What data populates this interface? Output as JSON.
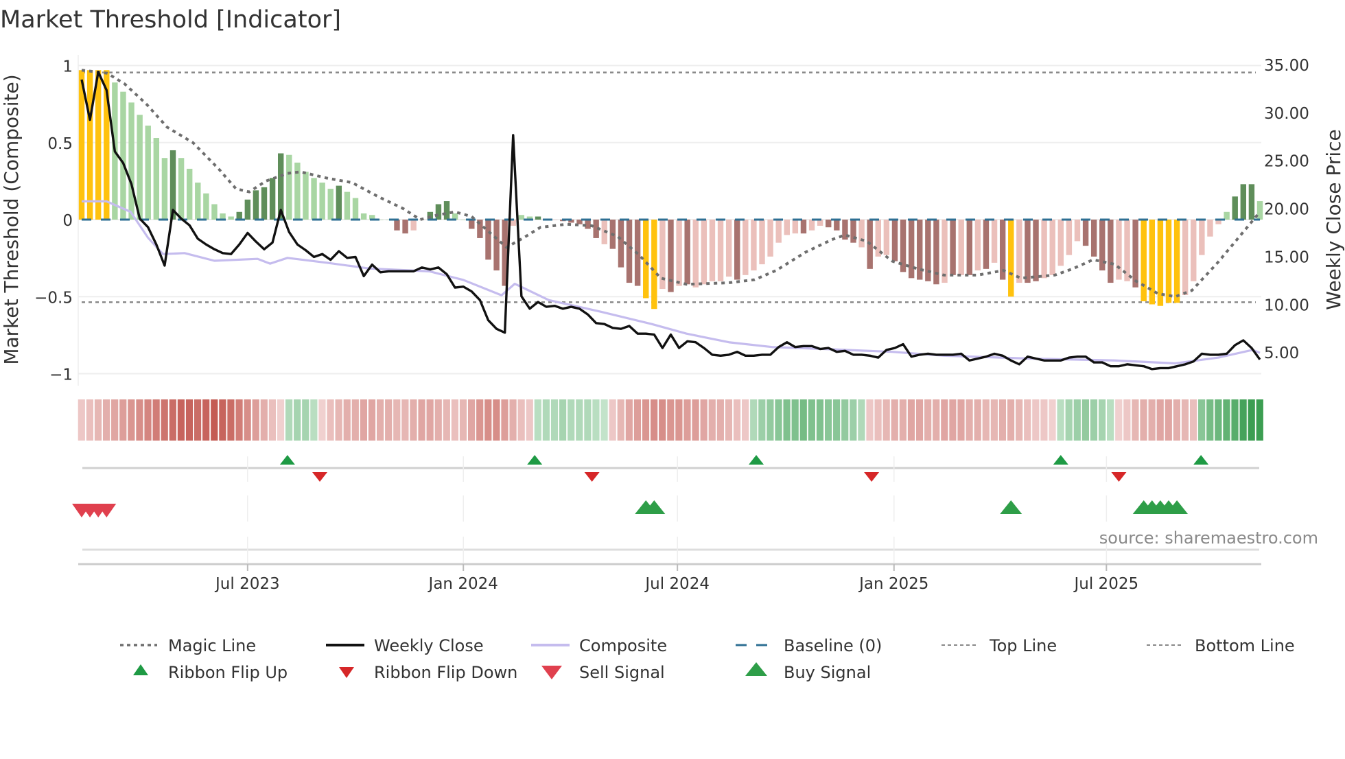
{
  "title": "Market Threshold [Indicator]",
  "source": "source: sharemaestro.com",
  "colors": {
    "Y": "#FFC20E",
    "G": "#A9D6A3",
    "D": "#5F8E5A",
    "r": "#EBC0BB",
    "R": "#A8736F",
    "close": "#111111",
    "composite": "#C5BCEE",
    "magic": "#6E6E6E",
    "baseline": "#2E6F93",
    "flip_up": "#1E9A44",
    "flip_down": "#D62728",
    "sell": "#E0404E",
    "buy": "#2E9E48"
  },
  "chart_data": {
    "type": "bar+line",
    "title": "Market Threshold [Indicator]",
    "ylabel": "Market Threshold (Composite)",
    "y2label": "Weekly Close Price",
    "ylim": [
      -1.05,
      1.05
    ],
    "y2lim": [
      2,
      36
    ],
    "yticks": [
      {
        "v": 1,
        "label": "1"
      },
      {
        "v": 0.5,
        "label": "0.5"
      },
      {
        "v": 0,
        "label": "0"
      },
      {
        "v": -0.5,
        "label": "−0.5"
      },
      {
        "v": -1,
        "label": "−1"
      }
    ],
    "y2ticks": [
      {
        "v": 35,
        "label": "35.00"
      },
      {
        "v": 30,
        "label": "30.00"
      },
      {
        "v": 25,
        "label": "25.00"
      },
      {
        "v": 20,
        "label": "20.00"
      },
      {
        "v": 15,
        "label": "15.00"
      },
      {
        "v": 10,
        "label": "10.00"
      },
      {
        "v": 5,
        "label": "5.00"
      }
    ],
    "xticks": [
      {
        "week": 20,
        "label": "Jul 2023"
      },
      {
        "week": 46,
        "label": "Jan 2024"
      },
      {
        "week": 71.8,
        "label": "Jul 2024"
      },
      {
        "week": 97.9,
        "label": "Jan 2025"
      },
      {
        "week": 123.5,
        "label": "Jul 2025"
      }
    ],
    "x_unit": "week index (weekly, ~Feb 2023 to ~Nov 2025)",
    "top_line": 0.955,
    "bottom_line": -0.536,
    "baseline": 0,
    "bars": {
      "values": [
        0.97,
        0.97,
        0.97,
        0.97,
        0.89,
        0.83,
        0.76,
        0.68,
        0.61,
        0.53,
        0.4,
        0.45,
        0.4,
        0.33,
        0.24,
        0.17,
        0.1,
        0.04,
        0.02,
        0.05,
        0.13,
        0.19,
        0.21,
        0.27,
        0.43,
        0.42,
        0.37,
        0.31,
        0.27,
        0.24,
        0.2,
        0.22,
        0.18,
        0.14,
        0.04,
        0.03,
        0,
        0,
        -0.07,
        -0.09,
        -0.07,
        0,
        0.05,
        0.1,
        0.12,
        0.04,
        0,
        -0.06,
        -0.12,
        -0.26,
        -0.33,
        -0.43,
        -0.04,
        0.03,
        0.02,
        0.02,
        0,
        0,
        -0.01,
        -0.02,
        -0.03,
        -0.06,
        -0.12,
        -0.16,
        -0.19,
        -0.31,
        -0.41,
        -0.43,
        -0.51,
        -0.58,
        -0.45,
        -0.47,
        -0.43,
        -0.42,
        -0.44,
        -0.42,
        -0.4,
        -0.4,
        -0.37,
        -0.39,
        -0.36,
        -0.33,
        -0.29,
        -0.24,
        -0.15,
        -0.1,
        -0.09,
        -0.09,
        -0.07,
        -0.04,
        -0.05,
        -0.07,
        -0.13,
        -0.15,
        -0.18,
        -0.32,
        -0.24,
        -0.23,
        -0.27,
        -0.34,
        -0.38,
        -0.39,
        -0.4,
        -0.42,
        -0.41,
        -0.36,
        -0.36,
        -0.36,
        -0.33,
        -0.32,
        -0.28,
        -0.39,
        -0.5,
        -0.41,
        -0.41,
        -0.4,
        -0.38,
        -0.36,
        -0.3,
        -0.23,
        -0.14,
        -0.17,
        -0.24,
        -0.33,
        -0.41,
        -0.39,
        -0.4,
        -0.44,
        -0.53,
        -0.55,
        -0.56,
        -0.54,
        -0.54,
        -0.49,
        -0.4,
        -0.23,
        -0.11,
        -0.03,
        0.05,
        0.15,
        0.23,
        0.23,
        0.12
      ],
      "color_codes": "YYYYGGGGGGGDGGGGGGGDDDDDDGGGGGGDGGGGGGRRrrDDDGGRRRRRrGGDDrRRRRRrRRRRYYrRrRrrrrrRrrrrrrrRrrRRRRrRrrRRRRRRrRrRrRrRYrRRrrrrrRRRRrrRYYYYYrrrrrGDDDG"
    },
    "weekly_close": [
      33.5,
      29.3,
      34.3,
      32.4,
      26,
      24.8,
      22.6,
      19,
      18.1,
      16.3,
      14.1,
      19.9,
      19,
      18.3,
      16.9,
      16.3,
      15.8,
      15.4,
      15.3,
      16.3,
      17.5,
      16.6,
      15.8,
      16.5,
      19.9,
      17.6,
      16.3,
      15.7,
      15.0,
      15.3,
      14.7,
      15.6,
      14.9,
      15,
      13,
      14.2,
      13.4,
      13.5,
      13.5,
      13.5,
      13.5,
      13.9,
      13.7,
      13.9,
      13.2,
      11.8,
      11.9,
      11.4,
      10.5,
      8.4,
      7.5,
      7.1,
      27.7,
      10.9,
      9.6,
      10.3,
      9.8,
      9.9,
      9.6,
      9.8,
      9.6,
      9.0,
      8.1,
      8.0,
      7.6,
      7.5,
      7.8,
      7.0,
      7.0,
      6.9,
      5.5,
      6.9,
      5.5,
      6.2,
      6.1,
      5.5,
      4.8,
      4.7,
      4.8,
      5.1,
      4.7,
      4.7,
      4.8,
      4.8,
      5.6,
      6.1,
      5.6,
      5.7,
      5.7,
      5.4,
      5.5,
      5.1,
      5.2,
      4.8,
      4.8,
      4.7,
      4.5,
      5.3,
      5.5,
      5.9,
      4.6,
      4.8,
      4.9,
      4.8,
      4.8,
      4.8,
      4.9,
      4.2,
      4.4,
      4.6,
      4.9,
      4.7,
      4.2,
      3.8,
      4.6,
      4.4,
      4.2,
      4.2,
      4.2,
      4.5,
      4.6,
      4.6,
      4.0,
      4.0,
      3.6,
      3.6,
      3.8,
      3.7,
      3.6,
      3.3,
      3.4,
      3.4,
      3.6,
      3.8,
      4.1,
      4.9,
      4.8,
      4.8,
      4.9,
      5.8,
      6.3,
      5.5,
      4.3
    ],
    "composite": [
      [
        0,
        20.8
      ],
      [
        3,
        20.8
      ],
      [
        5.9,
        19.7
      ],
      [
        8,
        17
      ],
      [
        9.8,
        15.3
      ],
      [
        12.4,
        15.4
      ],
      [
        16,
        14.6
      ],
      [
        21.2,
        14.8
      ],
      [
        22.7,
        14.3
      ],
      [
        24.8,
        14.9
      ],
      [
        29.5,
        14.4
      ],
      [
        34.6,
        13.8
      ],
      [
        41.9,
        13.5
      ],
      [
        46,
        12.6
      ],
      [
        50.6,
        11
      ],
      [
        52.2,
        12.2
      ],
      [
        56.3,
        10.5
      ],
      [
        62.5,
        9.3
      ],
      [
        68.7,
        8
      ],
      [
        72.9,
        7
      ],
      [
        78,
        6.1
      ],
      [
        83.2,
        5.6
      ],
      [
        89.4,
        5.4
      ],
      [
        97.7,
        5.1
      ],
      [
        103.9,
        4.7
      ],
      [
        114.2,
        4.4
      ],
      [
        124.5,
        4.2
      ],
      [
        131.8,
        3.9
      ],
      [
        137,
        4.5
      ],
      [
        141.1,
        5.3
      ],
      [
        142,
        5.0
      ]
    ],
    "magic_line": [
      [
        0,
        0.97
      ],
      [
        3.1,
        0.95
      ],
      [
        5.2,
        0.88
      ],
      [
        7.8,
        0.75
      ],
      [
        10.3,
        0.6
      ],
      [
        13.4,
        0.5
      ],
      [
        16.5,
        0.33
      ],
      [
        18.6,
        0.2
      ],
      [
        20.2,
        0.18
      ],
      [
        22.2,
        0.25
      ],
      [
        24.8,
        0.3
      ],
      [
        26.4,
        0.31
      ],
      [
        29.5,
        0.27
      ],
      [
        32.6,
        0.24
      ],
      [
        35.7,
        0.15
      ],
      [
        38.8,
        0.07
      ],
      [
        40.8,
        0
      ],
      [
        42.9,
        0.03
      ],
      [
        45,
        0.05
      ],
      [
        47,
        0.02
      ],
      [
        49.1,
        -0.08
      ],
      [
        51.2,
        -0.18
      ],
      [
        53.2,
        -0.12
      ],
      [
        55.3,
        -0.05
      ],
      [
        58.4,
        -0.03
      ],
      [
        61.5,
        -0.04
      ],
      [
        64.6,
        -0.11
      ],
      [
        67.2,
        -0.23
      ],
      [
        69.8,
        -0.38
      ],
      [
        72.9,
        -0.42
      ],
      [
        78,
        -0.41
      ],
      [
        81.1,
        -0.39
      ],
      [
        83.7,
        -0.33
      ],
      [
        87.3,
        -0.21
      ],
      [
        90.4,
        -0.13
      ],
      [
        92,
        -0.1
      ],
      [
        94.6,
        -0.14
      ],
      [
        97.7,
        -0.27
      ],
      [
        100.8,
        -0.32
      ],
      [
        103.9,
        -0.36
      ],
      [
        108,
        -0.36
      ],
      [
        111.1,
        -0.33
      ],
      [
        113.2,
        -0.38
      ],
      [
        117.3,
        -0.36
      ],
      [
        119.4,
        -0.32
      ],
      [
        121.9,
        -0.26
      ],
      [
        124.5,
        -0.29
      ],
      [
        127.1,
        -0.4
      ],
      [
        129.7,
        -0.48
      ],
      [
        131.8,
        -0.5
      ],
      [
        133.8,
        -0.46
      ],
      [
        136.9,
        -0.28
      ],
      [
        140,
        -0.08
      ],
      [
        142,
        0.05
      ]
    ],
    "ribbon": [
      -0.15,
      -0.2,
      -0.25,
      -0.3,
      -0.35,
      -0.4,
      -0.45,
      -0.5,
      -0.55,
      -0.6,
      -0.65,
      -0.7,
      -0.75,
      -0.75,
      -0.7,
      -0.75,
      -0.8,
      -0.75,
      -0.7,
      -0.6,
      -0.5,
      -0.4,
      -0.3,
      -0.2,
      -0.1,
      0.2,
      0.25,
      0.25,
      0.15,
      -0.1,
      -0.2,
      -0.25,
      -0.3,
      -0.3,
      -0.35,
      -0.35,
      -0.3,
      -0.3,
      -0.25,
      -0.25,
      -0.3,
      -0.35,
      -0.35,
      -0.3,
      -0.25,
      -0.2,
      -0.25,
      -0.35,
      -0.45,
      -0.5,
      -0.5,
      -0.4,
      -0.3,
      -0.2,
      -0.15,
      0.15,
      0.2,
      0.2,
      0.25,
      0.2,
      0.2,
      0.2,
      0.15,
      0.1,
      -0.15,
      -0.25,
      -0.35,
      -0.4,
      -0.45,
      -0.5,
      -0.5,
      -0.45,
      -0.45,
      -0.4,
      -0.4,
      -0.35,
      -0.3,
      -0.3,
      -0.25,
      -0.2,
      -0.15,
      0.2,
      0.3,
      0.35,
      0.4,
      0.45,
      0.45,
      0.5,
      0.45,
      0.45,
      0.4,
      0.4,
      0.35,
      0.3,
      0.2,
      -0.15,
      -0.2,
      -0.25,
      -0.3,
      -0.3,
      -0.35,
      -0.35,
      -0.3,
      -0.3,
      -0.35,
      -0.35,
      -0.35,
      -0.3,
      -0.3,
      -0.25,
      -0.25,
      -0.3,
      -0.3,
      -0.25,
      -0.2,
      -0.15,
      -0.15,
      -0.1,
      0.15,
      0.25,
      0.3,
      0.35,
      0.3,
      0.25,
      0.15,
      -0.1,
      -0.15,
      -0.25,
      -0.3,
      -0.3,
      -0.35,
      -0.35,
      -0.3,
      -0.25,
      -0.2,
      0.4,
      0.5,
      0.55,
      0.6,
      0.65,
      0.75,
      0.8,
      0.8
    ],
    "ribbon_flip_up": [
      24.8,
      54.6,
      81.3,
      118,
      134.9
    ],
    "ribbon_flip_down": [
      28.7,
      61.5,
      95.2,
      125
    ],
    "sell_signals": [
      0,
      1,
      2,
      3
    ],
    "buy_signals": [
      68,
      69,
      112,
      128,
      129,
      130,
      131,
      132
    ],
    "legend": [
      {
        "key": "magic",
        "label": "Magic Line"
      },
      {
        "key": "close",
        "label": "Weekly Close"
      },
      {
        "key": "composite",
        "label": "Composite"
      },
      {
        "key": "baseline",
        "label": "Baseline (0)"
      },
      {
        "key": "top",
        "label": "Top Line"
      },
      {
        "key": "bottom",
        "label": "Bottom Line"
      },
      {
        "key": "flip_up",
        "label": "Ribbon Flip Up"
      },
      {
        "key": "flip_down",
        "label": "Ribbon Flip Down"
      },
      {
        "key": "sell",
        "label": "Sell Signal"
      },
      {
        "key": "buy",
        "label": "Buy Signal"
      }
    ],
    "legend_position": "bottom"
  }
}
